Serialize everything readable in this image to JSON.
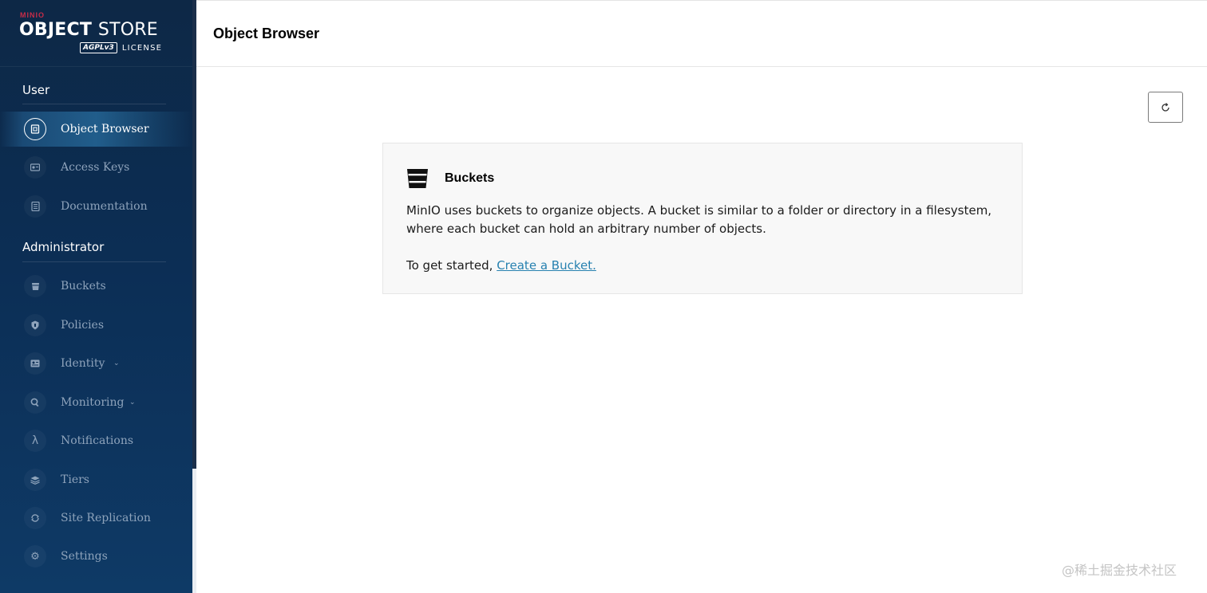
{
  "logo": {
    "brand": "MINIO",
    "title_bold": "OBJECT",
    "title_light": "STORE",
    "badge": "AGPLv3",
    "license": "LICENSE"
  },
  "sidebar": {
    "user_section": "User",
    "admin_section": "Administrator",
    "user_items": [
      {
        "label": "Object Browser",
        "icon": "object-browser-icon",
        "active": true
      },
      {
        "label": "Access Keys",
        "icon": "access-keys-icon"
      },
      {
        "label": "Documentation",
        "icon": "documentation-icon"
      }
    ],
    "admin_items": [
      {
        "label": "Buckets",
        "icon": "bucket-icon"
      },
      {
        "label": "Policies",
        "icon": "shield-icon"
      },
      {
        "label": "Identity",
        "icon": "identity-icon",
        "expandable": true
      },
      {
        "label": "Monitoring",
        "icon": "monitoring-icon",
        "expandable": true
      },
      {
        "label": "Notifications",
        "icon": "lambda-icon"
      },
      {
        "label": "Tiers",
        "icon": "tiers-icon"
      },
      {
        "label": "Site Replication",
        "icon": "replication-icon"
      },
      {
        "label": "Settings",
        "icon": "gear-icon"
      }
    ]
  },
  "header": {
    "title": "Object Browser"
  },
  "toolbar": {
    "refresh_icon": "refresh-icon"
  },
  "card": {
    "icon": "bucket-icon",
    "title": "Buckets",
    "description": "MinIO uses buckets to organize objects. A bucket is similar to a folder or directory in a filesystem, where each bucket can hold an arbitrary number of objects.",
    "cta_prefix": "To get started,",
    "cta_link": "Create a Bucket."
  },
  "watermark": "@稀土掘金技术社区",
  "colors": {
    "sidebar_bg": "#0c2e55",
    "link": "#2781b0",
    "brand_red": "#c72c48"
  }
}
